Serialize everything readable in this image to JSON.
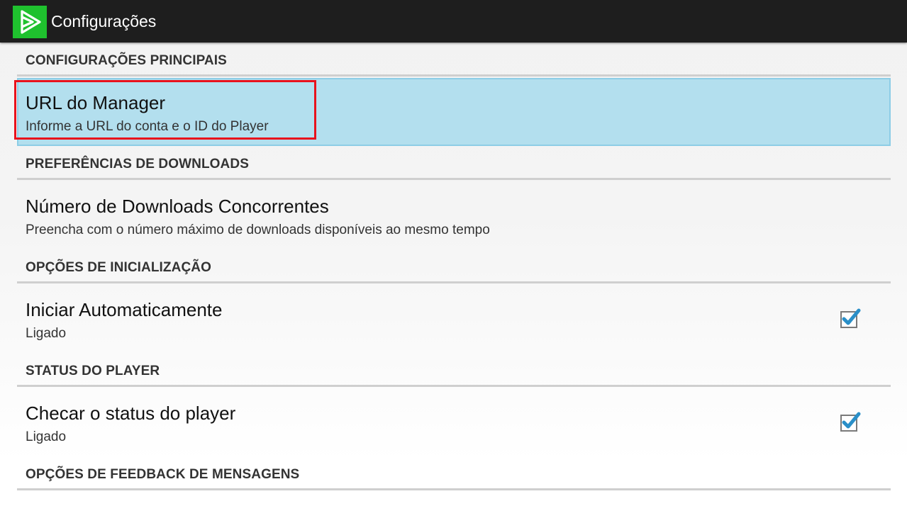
{
  "action_bar": {
    "title": "Configurações",
    "icon": "app-play-logo-icon",
    "icon_color": "#1fc12e"
  },
  "sections": [
    {
      "header": "CONFIGURAÇÕES PRINCIPAIS",
      "items": [
        {
          "title": "URL do Manager",
          "summary": "Informe a URL do conta e o ID do Player",
          "highlighted": true
        }
      ]
    },
    {
      "header": "PREFERÊNCIAS DE DOWNLOADS",
      "items": [
        {
          "title": "Número de Downloads Concorrentes",
          "summary": "Preencha com o número máximo de downloads disponíveis ao mesmo tempo"
        }
      ]
    },
    {
      "header": "OPÇÕES DE INICIALIZAÇÃO",
      "items": [
        {
          "title": "Iniciar Automaticamente",
          "summary": "Ligado",
          "checkbox": true,
          "checked": true
        }
      ]
    },
    {
      "header": "STATUS DO PLAYER",
      "items": [
        {
          "title": "Checar o status do player",
          "summary": "Ligado",
          "checkbox": true,
          "checked": true
        }
      ]
    },
    {
      "header": "OPÇÕES DE FEEDBACK DE MENSAGENS",
      "items": []
    }
  ],
  "colors": {
    "highlight_bg": "#b3dfee",
    "annotation_red": "#e8121c",
    "checkbox_check": "#2a8fc8"
  }
}
